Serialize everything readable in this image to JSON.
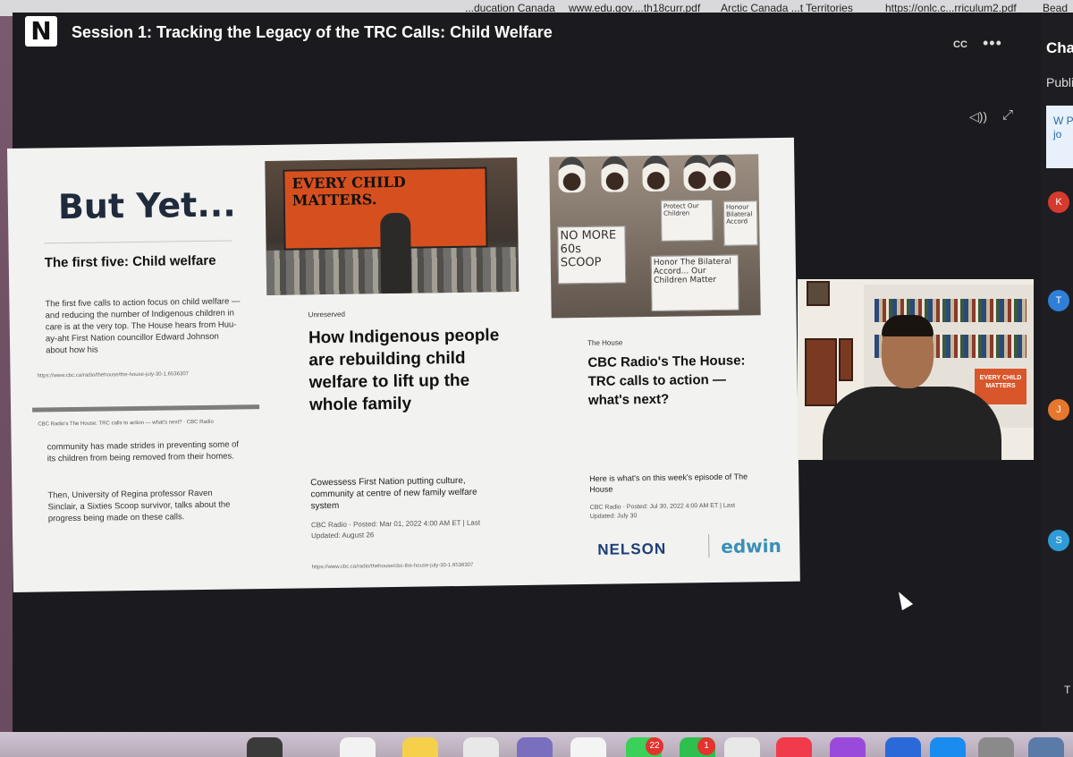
{
  "bookmarks": [
    {
      "label": "...ducation Canada"
    },
    {
      "label": "www.edu.gov....th18curr.pdf"
    },
    {
      "label": "Arctic Canada ...t Territories"
    },
    {
      "label": "https://onlc.c...rriculum2.pdf"
    },
    {
      "label": "Bead"
    }
  ],
  "app": {
    "logo_letter": "N",
    "session_title": "Session 1: Tracking the Legacy of the TRC Calls: Child Welfare",
    "cc_label": "CC",
    "more_label": "•••"
  },
  "slide": {
    "title": "But Yet...",
    "col1": {
      "heading": "The first five: Child welfare",
      "body": "The first five calls to action focus on child welfare — and reducing the number of Indigenous children in care is at the very top. The House hears from Huu-ay-aht First Nation councillor Edward Johnson about how his",
      "url": "https://www.cbc.ca/radio/thehouse/the-house-july-30-1.6536307",
      "caption": "CBC Radio's The House: TRC calls to action — what's next? · CBC Radio",
      "body2": "community has made strides in preventing some of its children from being removed from their homes.",
      "body3": "Then, University of Regina professor Raven Sinclair, a Sixties Scoop survivor, talks about the progress being made on these calls."
    },
    "col2": {
      "banner_text": "EVERY CHILD MATTERS.",
      "source": "Unreserved",
      "headline": "How Indigenous people are rebuilding child welfare to lift up the whole family",
      "sub": "Cowessess First Nation putting culture, community at centre of new family welfare system",
      "byline": "CBC Radio · Posted: Mar 01, 2022 4:00 AM ET | Last Updated: August 26",
      "url": "https://www.cbc.ca/radio/thehouse/cbc-the-house-july-30-1.6536307"
    },
    "col3": {
      "signs": [
        "NO MORE 60s SCOOP",
        "Protect Our Children",
        "Honour Bilateral Accord",
        "Honor The Bilateral Accord... Our Children Matter"
      ],
      "source": "The House",
      "headline": "CBC Radio's The House: TRC calls to action — what's next?",
      "sub": "Here is what's on this week's episode of The House",
      "byline": "CBC Radio · Posted: Jul 30, 2022 4:00 AM ET | Last Updated: July 30"
    },
    "logos": {
      "nelson": "NELSON",
      "edwin": "edwin"
    }
  },
  "presenter": {
    "poster_text": "EVERY CHILD MATTERS"
  },
  "chat": {
    "title": "Chat",
    "tab": "Public",
    "message": "W Pl jo",
    "avatars": [
      {
        "letter": "K",
        "color": "#d63a2f"
      },
      {
        "letter": "T",
        "color": "#2f7fd6"
      },
      {
        "letter": "J",
        "color": "#e8772e"
      },
      {
        "letter": "S",
        "color": "#2f9bd6"
      }
    ],
    "footer": "T"
  },
  "dock": {
    "badges": [
      "22",
      "1"
    ]
  }
}
